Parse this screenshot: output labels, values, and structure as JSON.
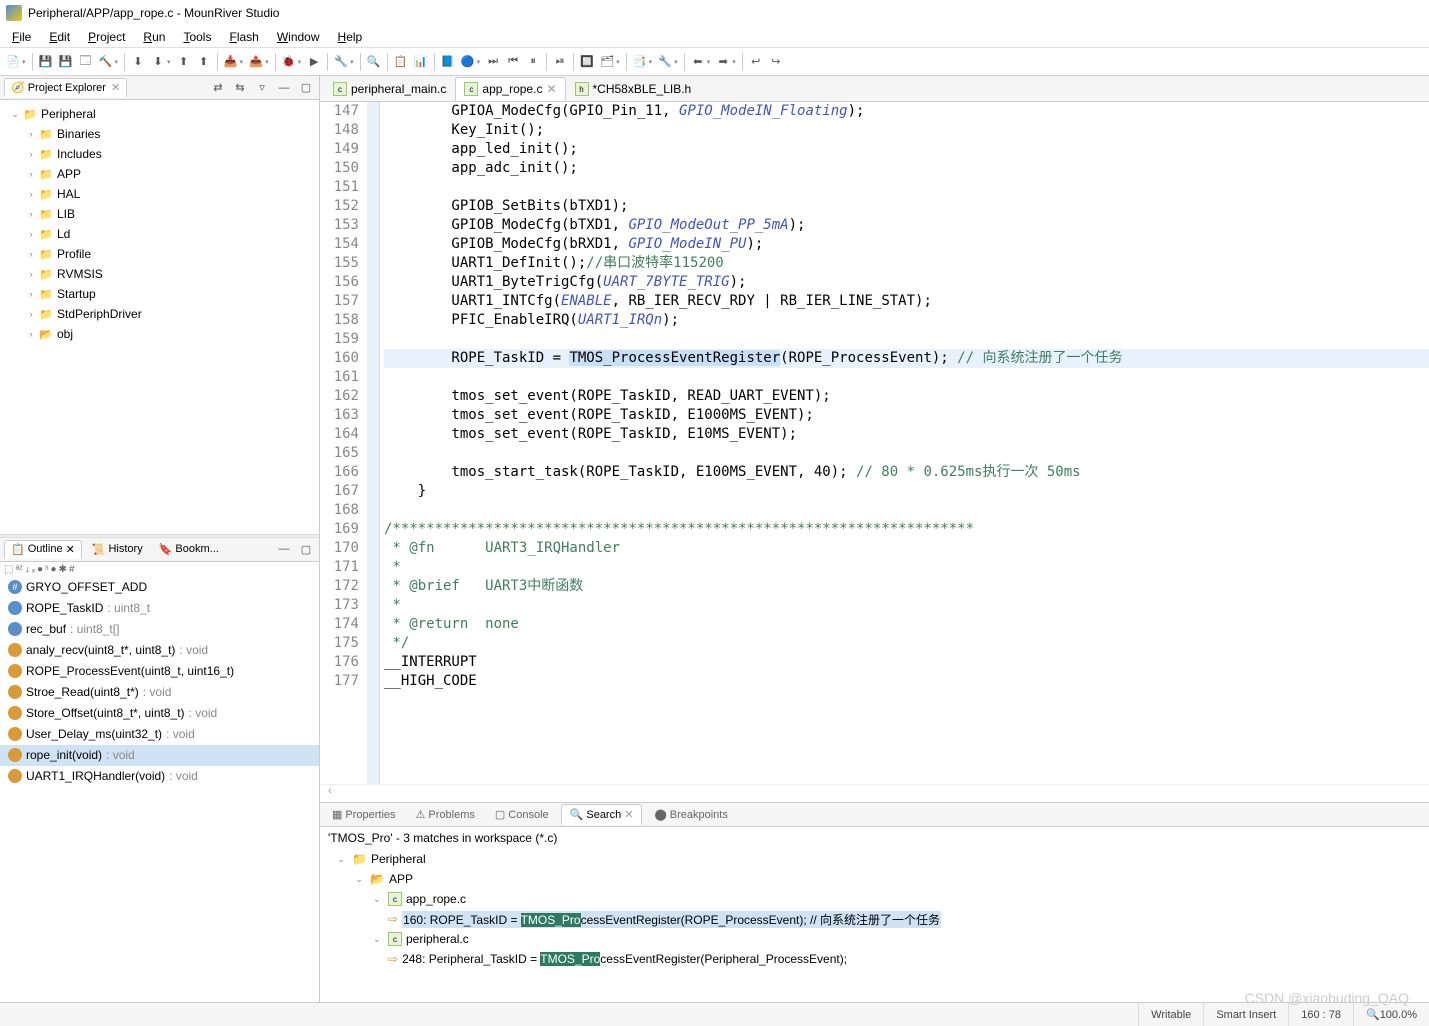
{
  "title": "Peripheral/APP/app_rope.c - MounRiver Studio",
  "menu": [
    "File",
    "Edit",
    "Project",
    "Run",
    "Tools",
    "Flash",
    "Window",
    "Help"
  ],
  "projectExplorer": {
    "title": "Project Explorer",
    "root": "Peripheral",
    "items": [
      "Binaries",
      "Includes",
      "APP",
      "HAL",
      "LIB",
      "Ld",
      "Profile",
      "RVMSIS",
      "Startup",
      "StdPeriphDriver",
      "obj"
    ]
  },
  "outline": {
    "title": "Outline",
    "tabs": [
      "History",
      "Bookm..."
    ],
    "items": [
      {
        "icon": "#",
        "color": "#5b8fc7",
        "label": "GRYO_OFFSET_ADD"
      },
      {
        "icon": "●",
        "color": "#5b8fc7",
        "label": "ROPE_TaskID",
        "type": ": uint8_t"
      },
      {
        "icon": "●",
        "color": "#5b8fc7",
        "label": "rec_buf",
        "type": ": uint8_t[]"
      },
      {
        "icon": "●",
        "color": "#d99a3a",
        "label": "analy_recv(uint8_t*, uint8_t)",
        "type": ": void"
      },
      {
        "icon": "●",
        "color": "#d99a3a",
        "label": "ROPE_ProcessEvent(uint8_t, uint16_t)",
        "type": ""
      },
      {
        "icon": "●",
        "color": "#d99a3a",
        "label": "Stroe_Read(uint8_t*)",
        "type": ": void"
      },
      {
        "icon": "●",
        "color": "#d99a3a",
        "label": "Store_Offset(uint8_t*, uint8_t)",
        "type": ": void"
      },
      {
        "icon": "●",
        "color": "#d99a3a",
        "label": "User_Delay_ms(uint32_t)",
        "type": ": void"
      },
      {
        "icon": "●",
        "color": "#d99a3a",
        "label": "rope_init(void)",
        "type": ": void",
        "selected": true
      },
      {
        "icon": "●",
        "color": "#d99a3a",
        "label": "UART1_IRQHandler(void)",
        "type": ": void"
      }
    ]
  },
  "editorTabs": [
    {
      "name": "peripheral_main.c",
      "active": false
    },
    {
      "name": "app_rope.c",
      "active": true,
      "close": true
    },
    {
      "name": "*CH58xBLE_LIB.h",
      "active": false
    }
  ],
  "code": {
    "start": 147,
    "lines": [
      {
        "t": "        GPIOA_ModeCfg(GPIO_Pin_11, ",
        "m": "GPIO_ModeIN_Floating",
        "t2": ");"
      },
      {
        "t": "        Key_Init();"
      },
      {
        "t": "        app_led_init();"
      },
      {
        "t": "        app_adc_init();"
      },
      {
        "t": ""
      },
      {
        "t": "        GPIOB_SetBits(bTXD1);"
      },
      {
        "t": "        GPIOB_ModeCfg(bTXD1, ",
        "m": "GPIO_ModeOut_PP_5mA",
        "t2": ");"
      },
      {
        "t": "        GPIOB_ModeCfg(bRXD1, ",
        "m": "GPIO_ModeIN_PU",
        "t2": ");"
      },
      {
        "t": "        UART1_DefInit();",
        "c": "//串口波特率115200"
      },
      {
        "t": "        UART1_ByteTrigCfg(",
        "m": "UART_7BYTE_TRIG",
        "t2": ");"
      },
      {
        "t": "        UART1_INTCfg(",
        "m": "ENABLE",
        "t2": ", RB_IER_RECV_RDY | RB_IER_LINE_STAT);"
      },
      {
        "t": "        PFIC_EnableIRQ(",
        "m": "UART1_IRQn",
        "t2": ");"
      },
      {
        "t": ""
      },
      {
        "hl": true,
        "t": "        ROPE_TaskID = ",
        "sel": "TMOS_ProcessEventRegister",
        "t2": "(ROPE_ProcessEvent); ",
        "c": "// 向系统注册了一个任务"
      },
      {
        "t": ""
      },
      {
        "t": "        tmos_set_event(ROPE_TaskID, READ_UART_EVENT);"
      },
      {
        "t": "        tmos_set_event(ROPE_TaskID, E1000MS_EVENT);"
      },
      {
        "t": "        tmos_set_event(ROPE_TaskID, E10MS_EVENT);"
      },
      {
        "t": ""
      },
      {
        "t": "        tmos_start_task(ROPE_TaskID, E100MS_EVENT, 40); ",
        "c": "// 80 * 0.625ms执行一次 50ms"
      },
      {
        "t": "    }"
      },
      {
        "t": ""
      },
      {
        "c": "/*********************************************************************"
      },
      {
        "c": " * @fn      UART3_IRQHandler"
      },
      {
        "c": " *"
      },
      {
        "c": " * @brief   UART3中断函数"
      },
      {
        "c": " *"
      },
      {
        "c": " * @return  none"
      },
      {
        "c": " */"
      },
      {
        "t": "__INTERRUPT"
      },
      {
        "t": "__HIGH_CODE"
      }
    ]
  },
  "bottomTabs": [
    "Properties",
    "Problems",
    "Console",
    "Search",
    "Breakpoints"
  ],
  "search": {
    "summary": "'TMOS_Pro' - 3 matches in workspace (*.c)",
    "tree": {
      "root": "Peripheral",
      "folder": "APP",
      "file1": "app_rope.c",
      "match1_pre": "160: ROPE_TaskID = ",
      "match1_hl": "TMOS_Pro",
      "match1_post": "cessEventRegister(ROPE_ProcessEvent); // 向系统注册了一个任务",
      "file2": "peripheral.c",
      "match2_pre": "248: Peripheral_TaskID = ",
      "match2_hl": "TMOS_Pro",
      "match2_post": "cessEventRegister(Peripheral_ProcessEvent);"
    }
  },
  "status": {
    "writable": "Writable",
    "insert": "Smart Insert",
    "pos": "160 : 78",
    "zoom": "100.0%"
  },
  "watermark": "CSDN @xiaobuding_QAQ"
}
